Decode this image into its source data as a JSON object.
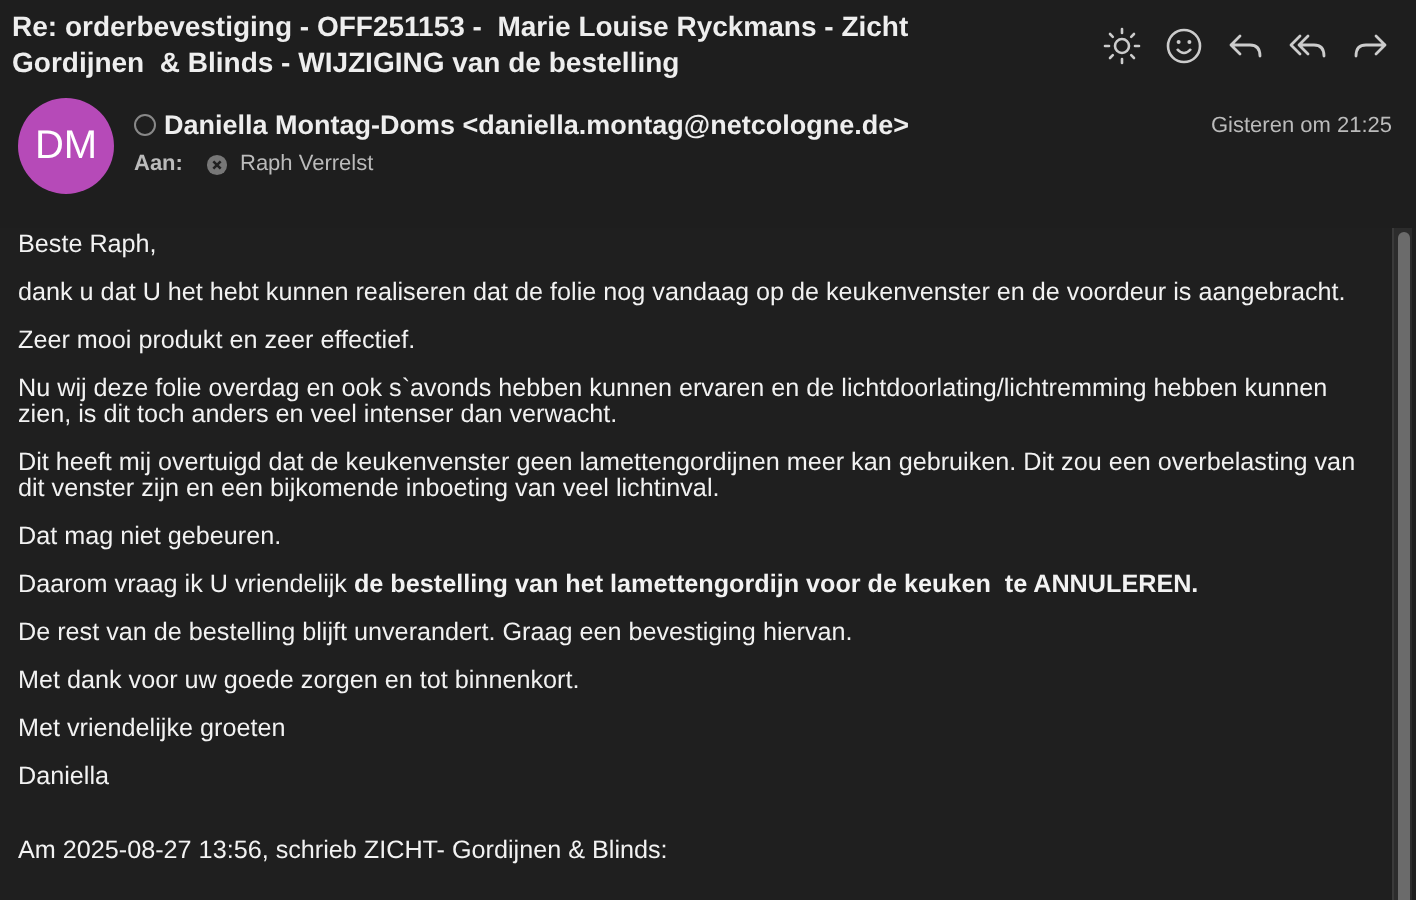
{
  "subject": "Re: orderbevestiging - OFF251153 -  Marie Louise Ryckmans - Zicht Gordijnen  & Blinds - WIJZIGING van de bestelling",
  "toolbar": [
    {
      "kind": "sun"
    },
    {
      "kind": "smiley"
    },
    {
      "kind": "reply"
    },
    {
      "kind": "reply_all"
    },
    {
      "kind": "forward"
    }
  ],
  "sender": {
    "initials": "DM",
    "name": "Daniella Montag-Doms <daniella.montag@netcologne.de>",
    "date": "Gisteren om 21:25"
  },
  "to": {
    "label": "Aan:",
    "recipient": "Raph Verrelst"
  },
  "body": [
    "Beste Raph,",
    "dank u dat U het hebt kunnen realiseren dat de folie nog vandaag op de keukenvenster en de voordeur is aangebracht.",
    "Zeer mooi produkt en zeer effectief.",
    "Nu wij deze folie overdag en ook s`avonds hebben kunnen ervaren en de lichtdoorlating/lichtremming hebben kunnen zien, is dit toch anders en veel intenser dan verwacht.",
    "Dit heeft mij overtuigd dat de keukenvenster geen lamettengordijnen meer kan gebruiken. Dit zou een overbelasting van dit venster zijn en een bijkomende inboeting van veel lichtinval.",
    "Dat mag niet gebeuren.",
    "Daarom vraag ik U vriendelijk **de bestelling van het lamettengordijn voor de keuken  te ANNULEREN.**",
    "De rest van de bestelling blijft unverandert. Graag een bevestiging hiervan.",
    "Met dank voor uw goede zorgen en tot binnenkort.",
    "Met vriendelijke groeten",
    "Daniella"
  ],
  "quote_header": "Am 2025-08-27 13:56, schrieb ZICHT- Gordijnen & Blinds:"
}
